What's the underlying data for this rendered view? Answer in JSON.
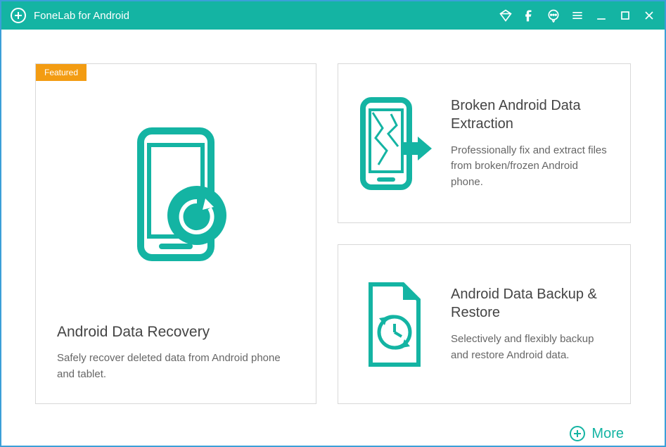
{
  "header": {
    "title": "FoneLab for Android"
  },
  "cards": {
    "recovery": {
      "badge": "Featured",
      "title": "Android Data Recovery",
      "desc": "Safely recover deleted data from Android phone and tablet."
    },
    "extraction": {
      "title": "Broken Android Data Extraction",
      "desc": "Professionally fix and extract files from broken/frozen Android phone."
    },
    "backup": {
      "title": "Android Data Backup & Restore",
      "desc": "Selectively and flexibly backup and restore Android data."
    }
  },
  "footer": {
    "more": "More"
  },
  "colors": {
    "primary": "#14b4a3",
    "accent": "#f39c12"
  }
}
